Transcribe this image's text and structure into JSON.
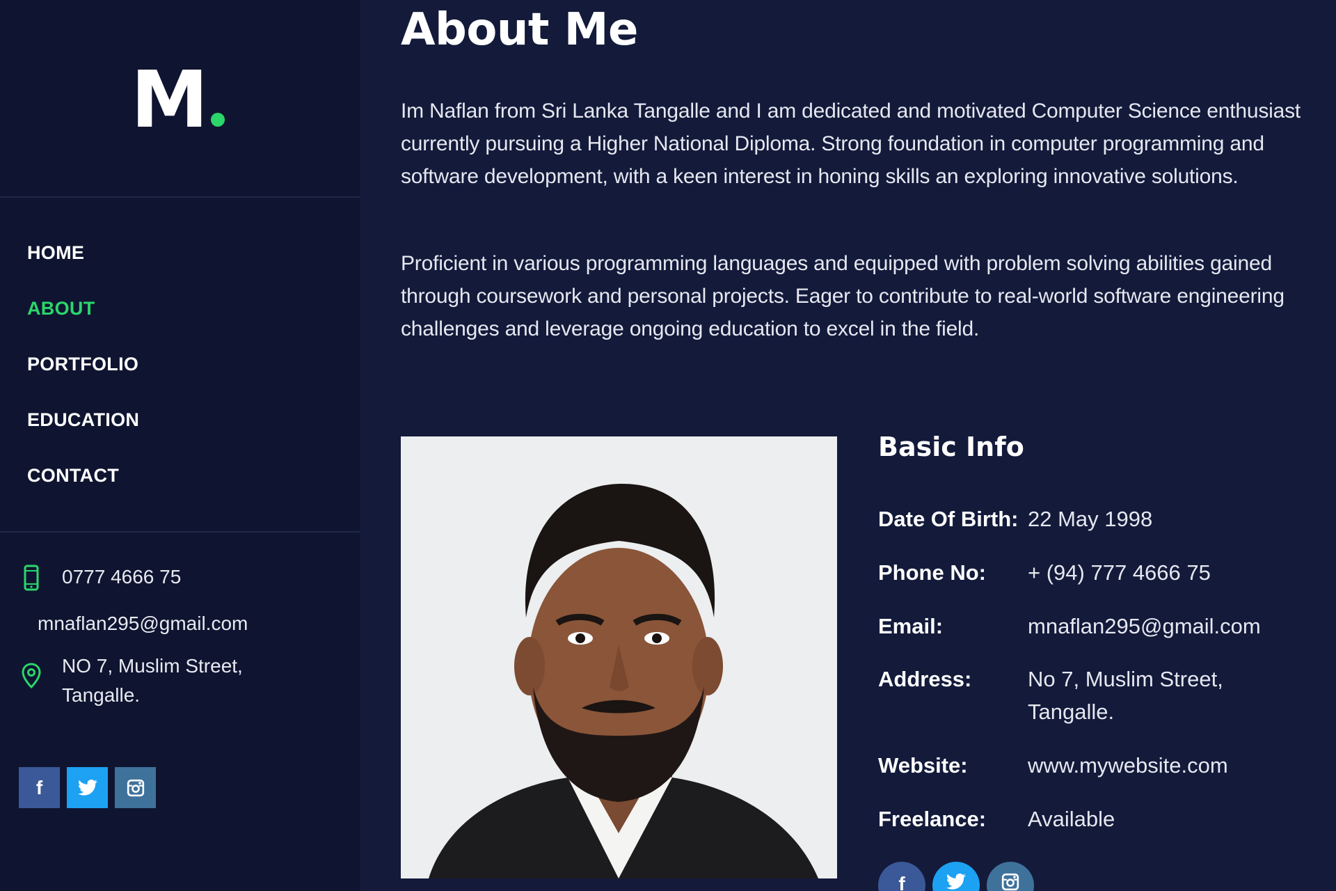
{
  "brand": {
    "logo_letter": "M",
    "accent_color": "#2bd66b"
  },
  "nav": {
    "items": [
      {
        "label": "HOME"
      },
      {
        "label": "ABOUT"
      },
      {
        "label": "PORTFOLIO"
      },
      {
        "label": "EDUCATION"
      },
      {
        "label": "CONTACT"
      }
    ],
    "active": "ABOUT"
  },
  "sidebar_contact": {
    "phone": "0777 4666 75",
    "email": "mnaflan295@gmail.com",
    "address_line1": "NO 7, Muslim Street,",
    "address_line2": "Tangalle.",
    "phone_icon": "phone-icon",
    "location_icon": "location-pin-icon"
  },
  "social": {
    "facebook_glyph": "f",
    "twitter_icon": "twitter-icon",
    "instagram_icon": "instagram-icon",
    "facebook_color": "#3b5998",
    "twitter_color": "#1da1f2",
    "instagram_color": "#3f729b"
  },
  "about": {
    "title": "About Me",
    "paragraph1": "Im Naflan from Sri Lanka Tangalle and I am dedicated and motivated Computer Science enthusiast currently pursuing a Higher National Diploma. Strong foundation in computer programming and software development, with a keen interest in honing skills an exploring innovative solutions.",
    "paragraph2": "Proficient in various programming languages and equipped with problem solving abilities gained through coursework and personal projects. Eager to contribute to real-world software engineering challenges and leverage ongoing education to excel in the field."
  },
  "basic_info": {
    "title": "Basic Info",
    "rows": [
      {
        "label": "Date Of Birth:",
        "value": "22 May 1998"
      },
      {
        "label": "Phone No:",
        "value": "+ (94) 777 4666 75"
      },
      {
        "label": "Email:",
        "value": "mnaflan295@gmail.com"
      },
      {
        "label": "Address:",
        "value": "No 7, Muslim Street, Tangalle."
      },
      {
        "label": "Website:",
        "value": "www.mywebsite.com"
      },
      {
        "label": "Freelance:",
        "value": "Available"
      }
    ]
  }
}
